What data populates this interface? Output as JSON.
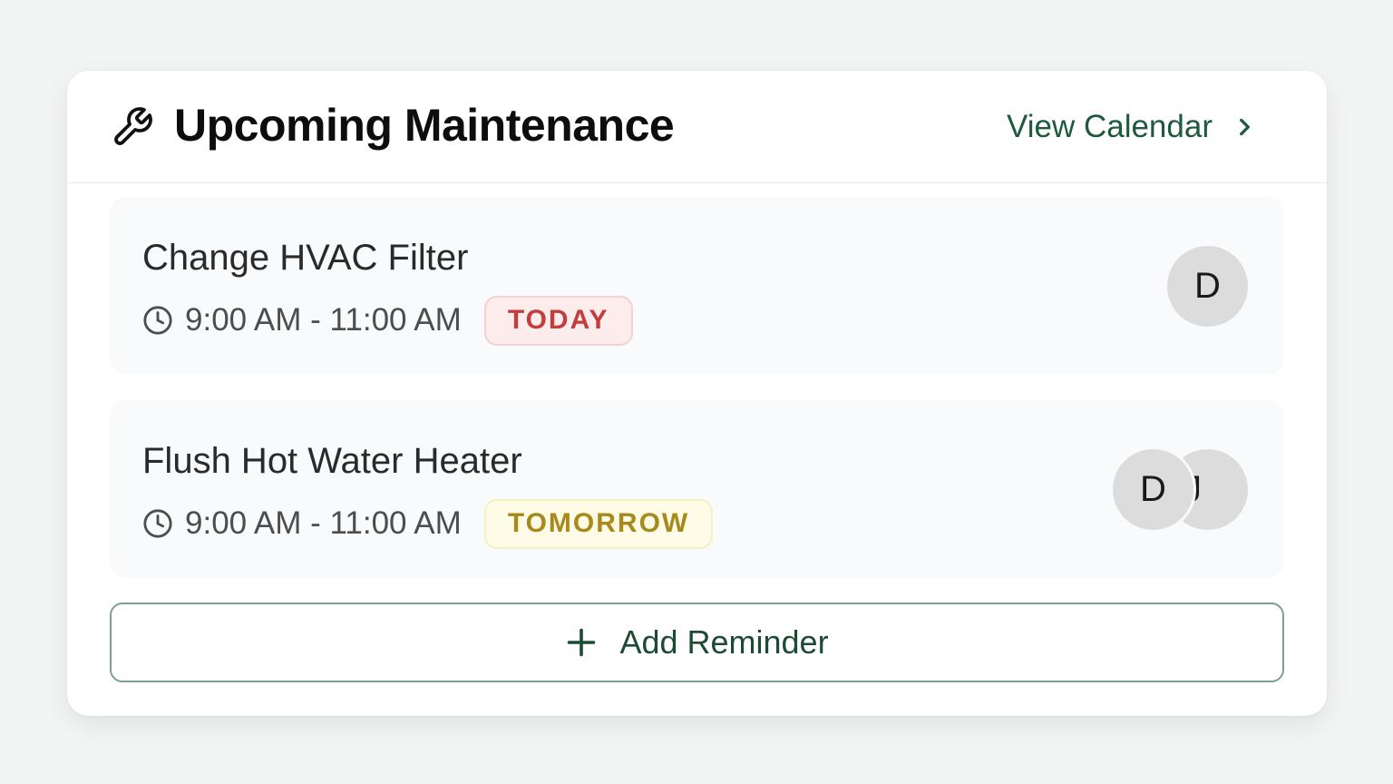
{
  "header": {
    "title": "Upcoming Maintenance",
    "view_calendar_label": "View Calendar",
    "icon": "wrench-icon"
  },
  "items": [
    {
      "name": "Change HVAC Filter",
      "time": "9:00 AM - 11:00 AM",
      "badge": "TODAY",
      "badge_color": "#c23d3d",
      "assignees": [
        "D"
      ]
    },
    {
      "name": "Flush Hot Water Heater",
      "time": "9:00 AM - 11:00 AM",
      "badge": "TOMORROW",
      "badge_color": "#a88a1c",
      "assignees": [
        "D",
        "J"
      ]
    }
  ],
  "add_button": {
    "label": "Add Reminder",
    "icon": "plus-icon"
  },
  "colors": {
    "accent": "#1d5a3d",
    "background": "#f3f4f4",
    "card": "#ffffff"
  }
}
